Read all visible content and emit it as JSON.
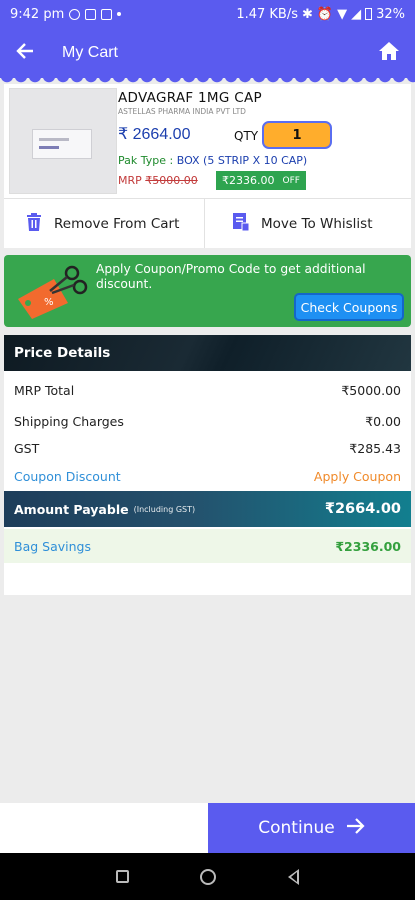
{
  "status_bar": {
    "time": "9:42 pm",
    "speed": "1.47 KB/s",
    "battery": "32%"
  },
  "app_bar": {
    "title": "My Cart",
    "back_icon": "back-arrow-icon",
    "home_icon": "home-icon"
  },
  "product": {
    "name": "ADVAGRAF 1MG CAP",
    "manufacturer": "ASTELLAS PHARMA INDIA PVT LTD",
    "price": "₹ 2664.00",
    "qty_label": "QTY",
    "qty_value": "1",
    "pack_label": "Pak Type : ",
    "pack_value": "BOX (5 STRIP X 10 CAP)",
    "mrp_label": "MRP ",
    "mrp_value": "₹5000.00",
    "discount_value": "₹2336.00",
    "discount_off": "OFF"
  },
  "actions": {
    "remove": "Remove From Cart",
    "move": "Move To Whislist"
  },
  "coupon_banner": {
    "text": "Apply Coupon/Promo Code to get additional discount.",
    "button": "Check Coupons"
  },
  "price_details": {
    "title": "Price Details",
    "rows": [
      {
        "label": "MRP Total",
        "value": "₹5000.00"
      },
      {
        "label": "Shipping Charges",
        "value": "₹0.00"
      },
      {
        "label": "GST",
        "value": "₹285.43"
      }
    ],
    "coupon_label": "Coupon Discount",
    "coupon_action": "Apply Coupon",
    "amount_label": "Amount Payable",
    "amount_sub": "(Including GST)",
    "amount_value": "₹2664.00",
    "savings_label": "Bag Savings",
    "savings_value": "₹2336.00"
  },
  "footer": {
    "continue_label": "Continue"
  },
  "colors": {
    "brand": "#5a5bef",
    "price_blue": "#1c3fae",
    "green": "#37a64e",
    "coupon_orange": "#f08a2a",
    "qty_orange": "#ffad2c"
  }
}
